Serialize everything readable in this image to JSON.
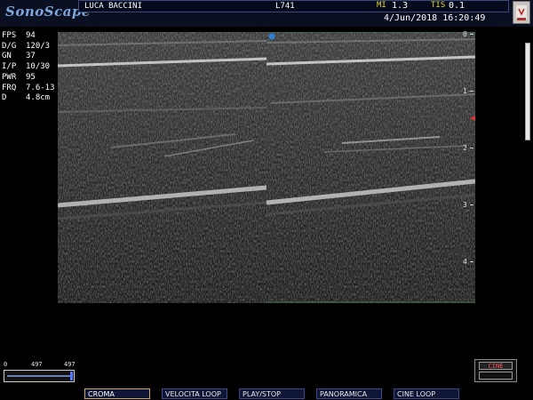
{
  "header": {
    "logo": "SonoScape",
    "patient_name": "LUCA BACCINI",
    "probe": "L741",
    "mi_label": "MI",
    "mi_value": "1.3",
    "tis_label": "TIS",
    "tis_value": "0.1",
    "datetime": "4/Jun/2018 16:20:49"
  },
  "params": [
    {
      "key": "FPS",
      "value": "94"
    },
    {
      "key": "D/G",
      "value": "120/3"
    },
    {
      "key": "GN",
      "value": "37"
    },
    {
      "key": "I/P",
      "value": "10/30"
    },
    {
      "key": "PWR",
      "value": "95"
    },
    {
      "key": "FRQ",
      "value": "7.6-13"
    },
    {
      "key": "D",
      "value": "4.8cm"
    }
  ],
  "depth_scale": [
    "0",
    "1",
    "2",
    "3",
    "4"
  ],
  "cine": {
    "min_label": "0",
    "mid_label": "497",
    "max_label": "497",
    "position_fraction": 1.0,
    "button_label": "CINE"
  },
  "softkeys": [
    {
      "label": "CROMA",
      "active": true
    },
    {
      "label": "VELOCITA LOOP",
      "active": false
    },
    {
      "label": "PLAY/STOP",
      "active": false
    },
    {
      "label": "PANORAMICA",
      "active": false
    },
    {
      "label": "CINE LOOP",
      "active": false
    }
  ],
  "colors": {
    "accent": "#7fa6d9",
    "mi_label": "#e8d23a",
    "focus_marker": "#dd3333",
    "softkey_active_border": "#d8a840"
  }
}
